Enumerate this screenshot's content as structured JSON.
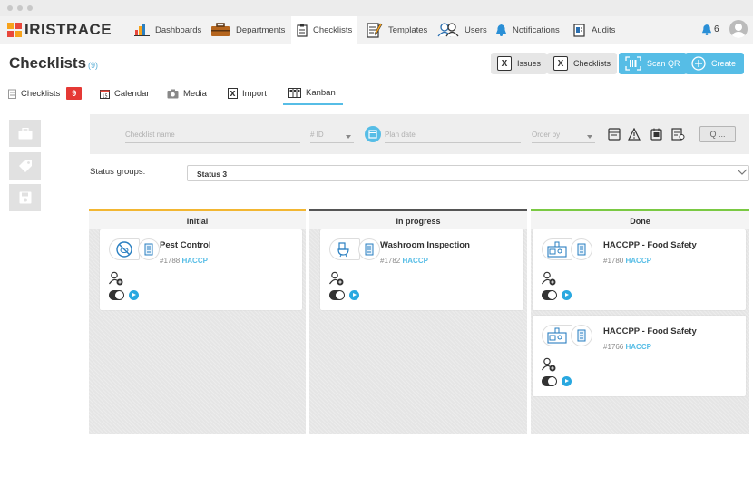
{
  "app": {
    "name": "IRISTRACE"
  },
  "nav": [
    {
      "label": "Dashboards",
      "icon": "bar-chart-icon"
    },
    {
      "label": "Departments",
      "icon": "briefcase-icon"
    },
    {
      "label": "Checklists",
      "icon": "clipboard-icon",
      "active": true
    },
    {
      "label": "Templates",
      "icon": "template-icon"
    },
    {
      "label": "Users",
      "icon": "users-icon"
    },
    {
      "label": "Notifications",
      "icon": "bell-icon"
    },
    {
      "label": "Audits",
      "icon": "audit-icon"
    }
  ],
  "header": {
    "notification_count": "6"
  },
  "page": {
    "title": "Checklists",
    "count": "(9)"
  },
  "actions": {
    "issues": "Issues",
    "checklists": "Checklists",
    "scan_qr": "Scan QR",
    "create": "Create"
  },
  "subtabs": {
    "checklists": "Checklists",
    "checklists_badge": "9",
    "calendar": "Calendar",
    "media": "Media",
    "import": "Import",
    "kanban": "Kanban"
  },
  "filters": {
    "name_placeholder": "Checklist name",
    "id_placeholder": "# ID",
    "plan_date_placeholder": "Plan date",
    "order_by_placeholder": "Order by",
    "search_label": "Q ..."
  },
  "status_groups": {
    "label": "Status groups:",
    "value": "Status 3"
  },
  "colors": {
    "initial": "#f2b632",
    "in_progress": "#555555",
    "done": "#7ac943",
    "accent": "#56bde6"
  },
  "columns": [
    {
      "title": "Initial",
      "cards": [
        {
          "title": "Pest Control",
          "id": "#1788",
          "tag": "HACCP",
          "icon": "no-pest-icon"
        }
      ]
    },
    {
      "title": "In progress",
      "cards": [
        {
          "title": "Washroom Inspection",
          "id": "#1782",
          "tag": "HACCP",
          "icon": "washroom-icon"
        }
      ]
    },
    {
      "title": "Done",
      "cards": [
        {
          "title": "HACCPP - Food Safety",
          "id": "#1780",
          "tag": "HACCP",
          "icon": "kitchen-icon"
        },
        {
          "title": "HACCPP - Food Safety",
          "id": "#1766",
          "tag": "HACCP",
          "icon": "kitchen-icon"
        }
      ]
    }
  ]
}
